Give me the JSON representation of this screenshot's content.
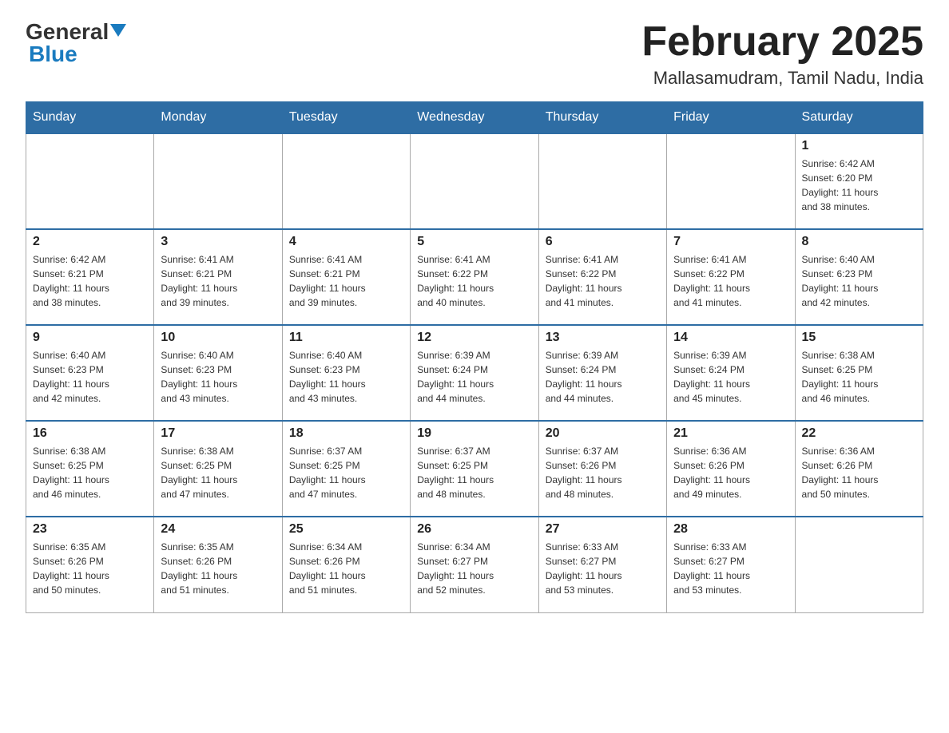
{
  "logo": {
    "general": "General",
    "blue": "Blue"
  },
  "title": "February 2025",
  "location": "Mallasamudram, Tamil Nadu, India",
  "days_of_week": [
    "Sunday",
    "Monday",
    "Tuesday",
    "Wednesday",
    "Thursday",
    "Friday",
    "Saturday"
  ],
  "weeks": [
    [
      {
        "day": "",
        "info": ""
      },
      {
        "day": "",
        "info": ""
      },
      {
        "day": "",
        "info": ""
      },
      {
        "day": "",
        "info": ""
      },
      {
        "day": "",
        "info": ""
      },
      {
        "day": "",
        "info": ""
      },
      {
        "day": "1",
        "info": "Sunrise: 6:42 AM\nSunset: 6:20 PM\nDaylight: 11 hours\nand 38 minutes."
      }
    ],
    [
      {
        "day": "2",
        "info": "Sunrise: 6:42 AM\nSunset: 6:21 PM\nDaylight: 11 hours\nand 38 minutes."
      },
      {
        "day": "3",
        "info": "Sunrise: 6:41 AM\nSunset: 6:21 PM\nDaylight: 11 hours\nand 39 minutes."
      },
      {
        "day": "4",
        "info": "Sunrise: 6:41 AM\nSunset: 6:21 PM\nDaylight: 11 hours\nand 39 minutes."
      },
      {
        "day": "5",
        "info": "Sunrise: 6:41 AM\nSunset: 6:22 PM\nDaylight: 11 hours\nand 40 minutes."
      },
      {
        "day": "6",
        "info": "Sunrise: 6:41 AM\nSunset: 6:22 PM\nDaylight: 11 hours\nand 41 minutes."
      },
      {
        "day": "7",
        "info": "Sunrise: 6:41 AM\nSunset: 6:22 PM\nDaylight: 11 hours\nand 41 minutes."
      },
      {
        "day": "8",
        "info": "Sunrise: 6:40 AM\nSunset: 6:23 PM\nDaylight: 11 hours\nand 42 minutes."
      }
    ],
    [
      {
        "day": "9",
        "info": "Sunrise: 6:40 AM\nSunset: 6:23 PM\nDaylight: 11 hours\nand 42 minutes."
      },
      {
        "day": "10",
        "info": "Sunrise: 6:40 AM\nSunset: 6:23 PM\nDaylight: 11 hours\nand 43 minutes."
      },
      {
        "day": "11",
        "info": "Sunrise: 6:40 AM\nSunset: 6:23 PM\nDaylight: 11 hours\nand 43 minutes."
      },
      {
        "day": "12",
        "info": "Sunrise: 6:39 AM\nSunset: 6:24 PM\nDaylight: 11 hours\nand 44 minutes."
      },
      {
        "day": "13",
        "info": "Sunrise: 6:39 AM\nSunset: 6:24 PM\nDaylight: 11 hours\nand 44 minutes."
      },
      {
        "day": "14",
        "info": "Sunrise: 6:39 AM\nSunset: 6:24 PM\nDaylight: 11 hours\nand 45 minutes."
      },
      {
        "day": "15",
        "info": "Sunrise: 6:38 AM\nSunset: 6:25 PM\nDaylight: 11 hours\nand 46 minutes."
      }
    ],
    [
      {
        "day": "16",
        "info": "Sunrise: 6:38 AM\nSunset: 6:25 PM\nDaylight: 11 hours\nand 46 minutes."
      },
      {
        "day": "17",
        "info": "Sunrise: 6:38 AM\nSunset: 6:25 PM\nDaylight: 11 hours\nand 47 minutes."
      },
      {
        "day": "18",
        "info": "Sunrise: 6:37 AM\nSunset: 6:25 PM\nDaylight: 11 hours\nand 47 minutes."
      },
      {
        "day": "19",
        "info": "Sunrise: 6:37 AM\nSunset: 6:25 PM\nDaylight: 11 hours\nand 48 minutes."
      },
      {
        "day": "20",
        "info": "Sunrise: 6:37 AM\nSunset: 6:26 PM\nDaylight: 11 hours\nand 48 minutes."
      },
      {
        "day": "21",
        "info": "Sunrise: 6:36 AM\nSunset: 6:26 PM\nDaylight: 11 hours\nand 49 minutes."
      },
      {
        "day": "22",
        "info": "Sunrise: 6:36 AM\nSunset: 6:26 PM\nDaylight: 11 hours\nand 50 minutes."
      }
    ],
    [
      {
        "day": "23",
        "info": "Sunrise: 6:35 AM\nSunset: 6:26 PM\nDaylight: 11 hours\nand 50 minutes."
      },
      {
        "day": "24",
        "info": "Sunrise: 6:35 AM\nSunset: 6:26 PM\nDaylight: 11 hours\nand 51 minutes."
      },
      {
        "day": "25",
        "info": "Sunrise: 6:34 AM\nSunset: 6:26 PM\nDaylight: 11 hours\nand 51 minutes."
      },
      {
        "day": "26",
        "info": "Sunrise: 6:34 AM\nSunset: 6:27 PM\nDaylight: 11 hours\nand 52 minutes."
      },
      {
        "day": "27",
        "info": "Sunrise: 6:33 AM\nSunset: 6:27 PM\nDaylight: 11 hours\nand 53 minutes."
      },
      {
        "day": "28",
        "info": "Sunrise: 6:33 AM\nSunset: 6:27 PM\nDaylight: 11 hours\nand 53 minutes."
      },
      {
        "day": "",
        "info": ""
      }
    ]
  ]
}
